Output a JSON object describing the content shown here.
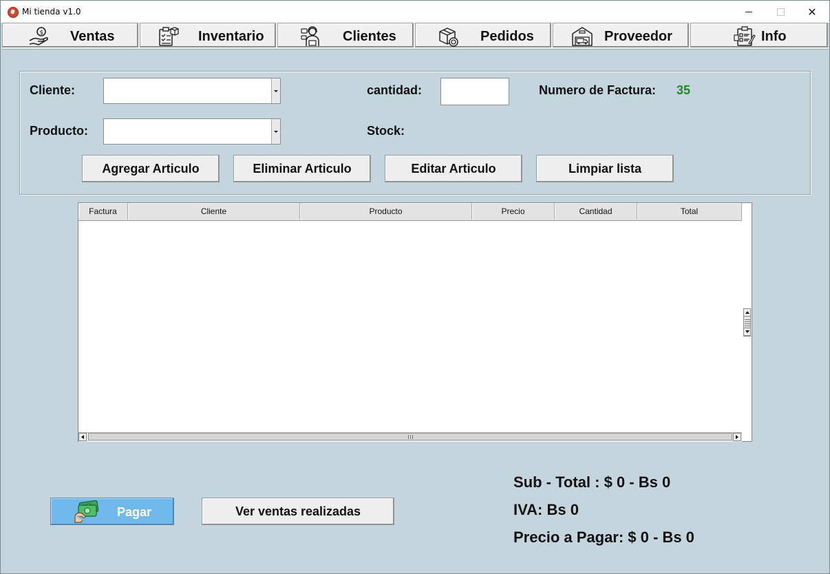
{
  "window": {
    "title": "Mi tienda v1.0",
    "controls": {
      "minimize": "–",
      "maximize": "□",
      "close": "✕"
    }
  },
  "nav": {
    "tabs": [
      {
        "label": "Ventas",
        "icon": "money-hand-icon"
      },
      {
        "label": "Inventario",
        "icon": "clipboard-box-icon"
      },
      {
        "label": "Clientes",
        "icon": "customer-service-icon"
      },
      {
        "label": "Pedidos",
        "icon": "package-order-icon"
      },
      {
        "label": "Proveedor",
        "icon": "warehouse-truck-icon"
      },
      {
        "label": "Info",
        "icon": "info-clipboard-icon"
      }
    ]
  },
  "form": {
    "cliente_label": "Cliente:",
    "cliente_value": "",
    "producto_label": "Producto:",
    "producto_value": "",
    "cantidad_label": "cantidad:",
    "cantidad_value": "",
    "stock_label": "Stock:",
    "stock_value": "",
    "factura_label": "Numero de Factura:",
    "factura_number": "35",
    "factura_color": "#1e8c1e"
  },
  "actions": {
    "add": "Agregar Articulo",
    "delete": "Eliminar Articulo",
    "edit": "Editar Articulo",
    "clear": "Limpiar lista"
  },
  "table": {
    "columns": [
      "Factura",
      "Cliente",
      "Producto",
      "Precio",
      "Cantidad",
      "Total"
    ],
    "rows": []
  },
  "footer": {
    "pay_label": "Pagar",
    "pay_color": "#6fb9ec",
    "sales_label": "Ver ventas realizadas",
    "subtotal": "Sub - Total : $ 0  -  Bs 0",
    "iva": "IVA: Bs 0",
    "total": "Precio a Pagar: $ 0  -  Bs 0"
  }
}
